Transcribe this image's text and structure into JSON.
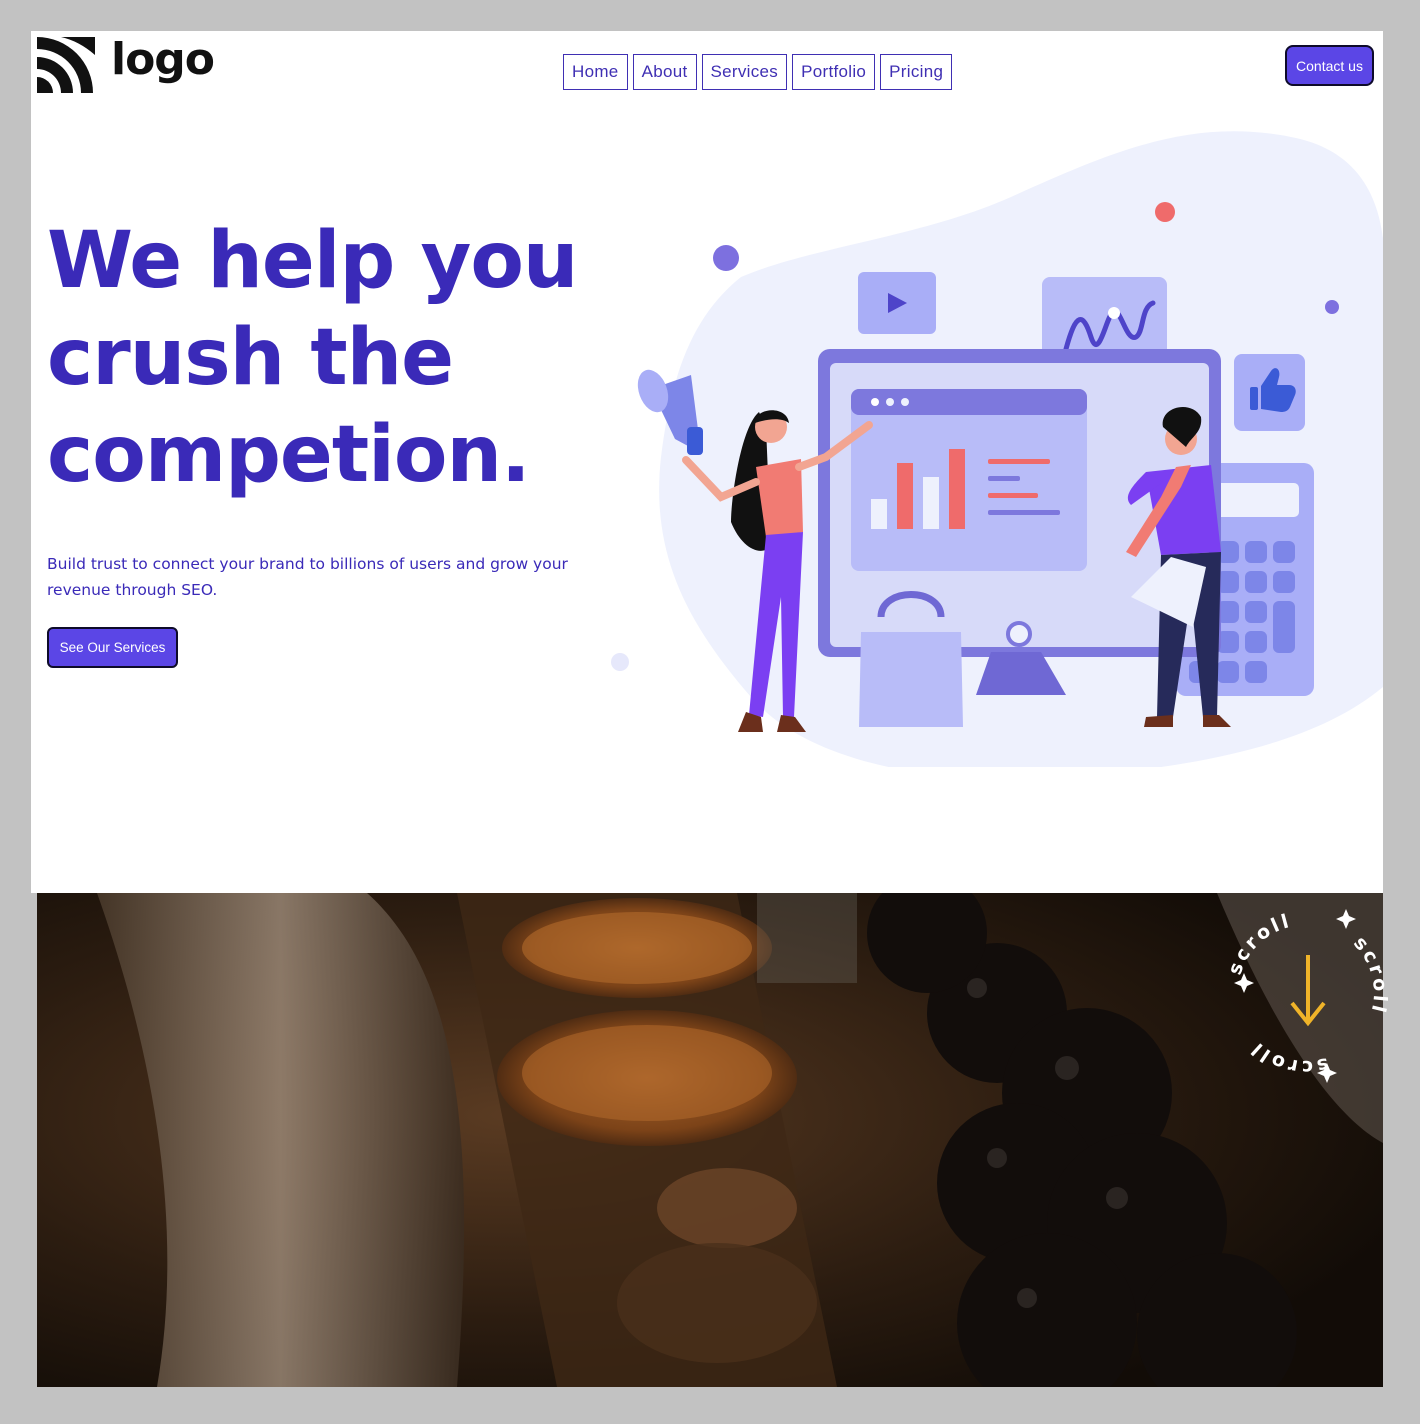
{
  "header": {
    "logo_text": "logo",
    "nav": [
      {
        "label": "Home"
      },
      {
        "label": "About"
      },
      {
        "label": "Services"
      },
      {
        "label": "Portfolio"
      },
      {
        "label": "Pricing"
      }
    ],
    "contact_label": "Contact us"
  },
  "hero": {
    "title": "We help you crush the competion.",
    "subtitle": "Build trust to connect your brand to billions of users and grow your revenue through SEO.",
    "cta_label": "See Our Services",
    "illustration_icons": [
      "megaphone-icon",
      "play-icon",
      "waveform-icon",
      "thumbs-up-icon",
      "bar-chart-icon",
      "shopping-bag-icon",
      "calculator-icon"
    ]
  },
  "photo_section": {
    "scroll_badge_text": "scroll",
    "arrow_icon": "arrow-down-icon"
  },
  "colors": {
    "brand": "#3a2ab8",
    "button": "#5b46e6",
    "accent_coral": "#ef6b6b",
    "arrow": "#f0b429"
  }
}
